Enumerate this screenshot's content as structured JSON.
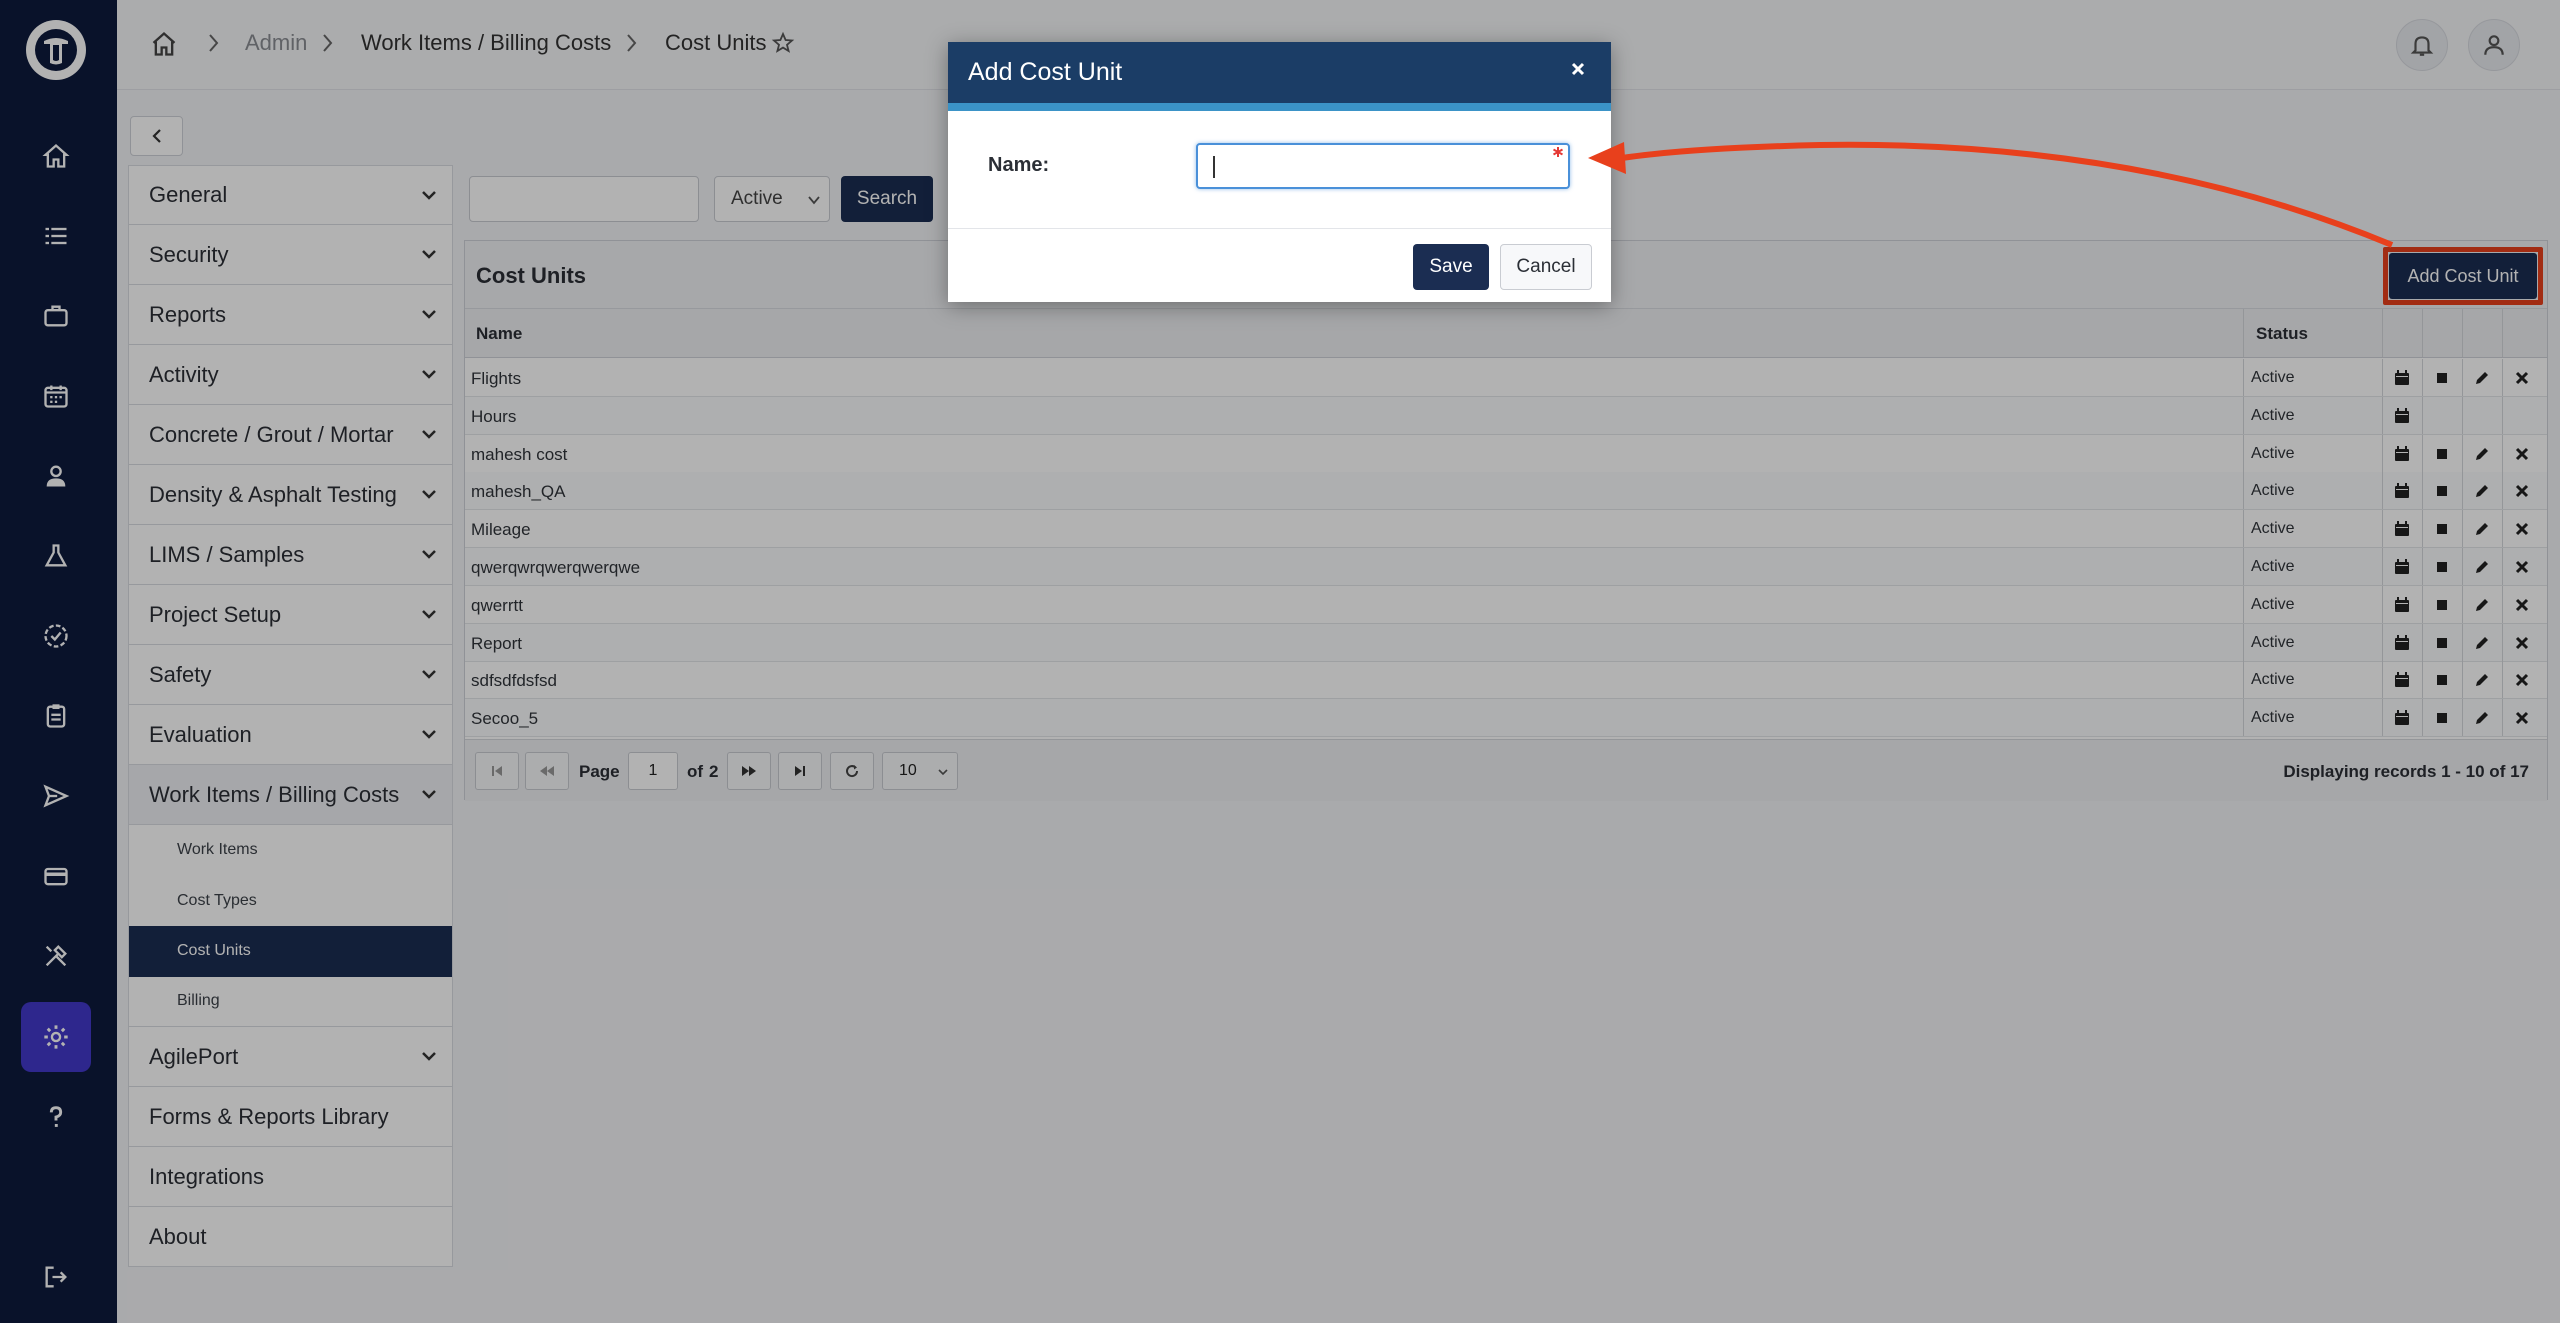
{
  "breadcrumb": {
    "admin": "Admin",
    "section": "Work Items / Billing Costs",
    "current": "Cost Units"
  },
  "menu": {
    "items": [
      {
        "label": "General"
      },
      {
        "label": "Security"
      },
      {
        "label": "Reports"
      },
      {
        "label": "Activity"
      },
      {
        "label": "Concrete / Grout / Mortar"
      },
      {
        "label": "Density & Asphalt Testing"
      },
      {
        "label": "LIMS / Samples"
      },
      {
        "label": "Project Setup"
      },
      {
        "label": "Safety"
      },
      {
        "label": "Evaluation"
      },
      {
        "label": "Work Items / Billing Costs"
      }
    ],
    "sub_items": [
      {
        "label": "Work Items"
      },
      {
        "label": "Cost Types"
      },
      {
        "label": "Cost Units"
      },
      {
        "label": "Billing"
      }
    ],
    "bottom_items": [
      {
        "label": "AgilePort"
      },
      {
        "label": "Forms & Reports Library"
      },
      {
        "label": "Integrations"
      },
      {
        "label": "About"
      }
    ]
  },
  "filters": {
    "search_value": "",
    "status_value": "Active",
    "search_button": "Search"
  },
  "grid": {
    "title": "Cost Units",
    "add_button": "Add Cost Unit",
    "columns": [
      "Name",
      "Status"
    ],
    "rows": [
      {
        "name": "Flights",
        "status": "Active"
      },
      {
        "name": "Hours",
        "status": "Active"
      },
      {
        "name": "mahesh cost",
        "status": "Active"
      },
      {
        "name": "mahesh_QA",
        "status": "Active"
      },
      {
        "name": "Mileage",
        "status": "Active"
      },
      {
        "name": "qwerqwrqwerqwerqwe",
        "status": "Active"
      },
      {
        "name": "qwerrtt",
        "status": "Active"
      },
      {
        "name": "Report",
        "status": "Active"
      },
      {
        "name": "sdfsdfdsfsd",
        "status": "Active"
      },
      {
        "name": "Secoo_5",
        "status": "Active"
      }
    ]
  },
  "pager": {
    "page_label": "Page",
    "page_value": "1",
    "of_label": "of",
    "total_pages": "2",
    "page_size": "10",
    "records_text": "Displaying records  1 - 10  of  17"
  },
  "modal": {
    "title": "Add Cost Unit",
    "name_label": "Name:",
    "name_value": "",
    "save": "Save",
    "cancel": "Cancel"
  },
  "colors": {
    "rail": "#0e1a3d",
    "accent_active": "#4338ca",
    "primary_button": "#1b2d52",
    "modal_header": "#1b3d66",
    "annotation": "#e8401c"
  }
}
